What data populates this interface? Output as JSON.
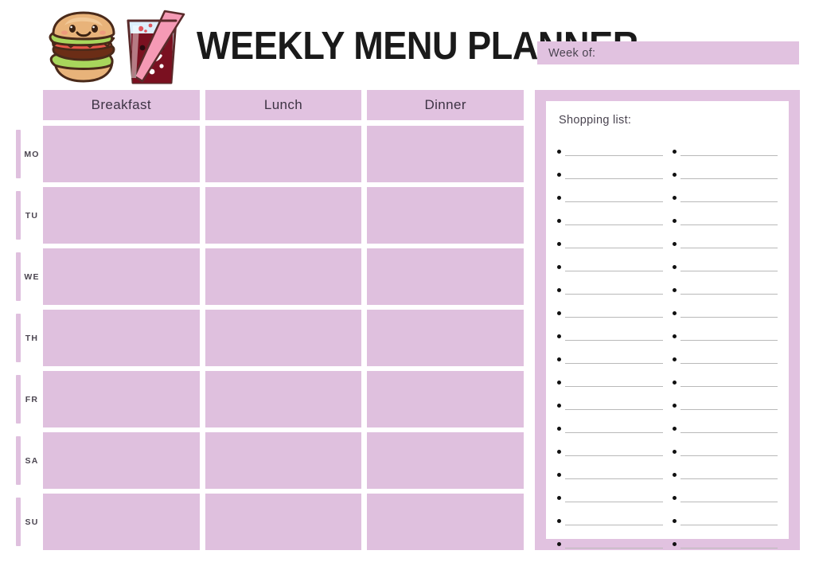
{
  "header": {
    "title": "WEEKLY MENU PLANNER",
    "week_of_label": "Week of:",
    "mascot_icons": [
      "burger-icon",
      "soda-drink-icon"
    ]
  },
  "planner": {
    "columns": [
      "Breakfast",
      "Lunch",
      "Dinner"
    ],
    "days": [
      "MO",
      "TU",
      "WE",
      "TH",
      "FR",
      "SA",
      "SU"
    ],
    "cell_values": [
      [
        "",
        "",
        ""
      ],
      [
        "",
        "",
        ""
      ],
      [
        "",
        "",
        ""
      ],
      [
        "",
        "",
        ""
      ],
      [
        "",
        "",
        ""
      ],
      [
        "",
        "",
        ""
      ],
      [
        "",
        "",
        ""
      ]
    ]
  },
  "shopping_list": {
    "title": "Shopping list:",
    "lines_per_column": 18,
    "columns": 2,
    "left_column": [
      "",
      "",
      "",
      "",
      "",
      "",
      "",
      "",
      "",
      "",
      "",
      "",
      "",
      "",
      "",
      "",
      "",
      ""
    ],
    "right_column": [
      "",
      "",
      "",
      "",
      "",
      "",
      "",
      "",
      "",
      "",
      "",
      "",
      "",
      "",
      "",
      "",
      "",
      ""
    ]
  },
  "colors": {
    "lilac": "#dfc0de",
    "lilac_header": "#e1c2e0",
    "page_background": "#ffffff",
    "text_dark": "#1a1a1a",
    "text_muted": "#4a4450",
    "rule_gray": "#b9b9b9"
  }
}
